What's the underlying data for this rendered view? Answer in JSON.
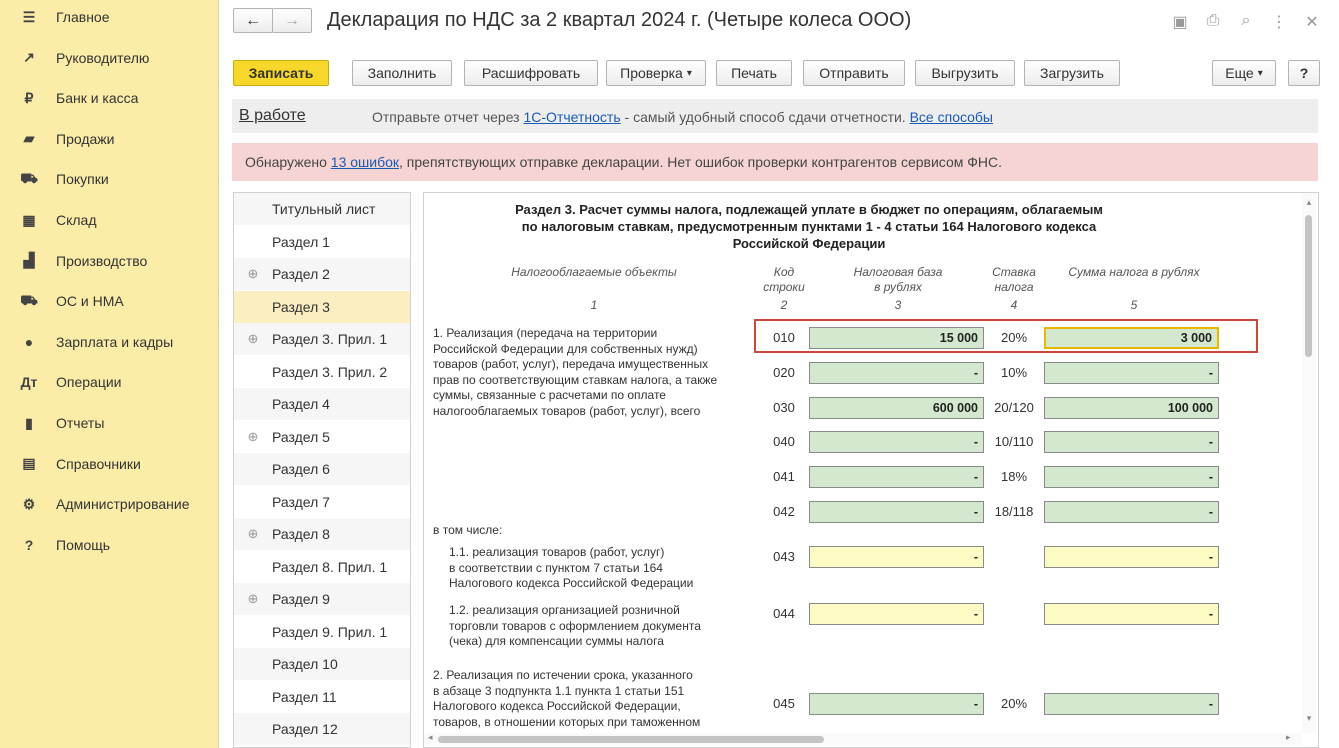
{
  "sidebar": {
    "items": [
      {
        "label": "Главное",
        "icon": "menu-icon",
        "glyph": "☰"
      },
      {
        "label": "Руководителю",
        "icon": "trend-icon",
        "glyph": "↗"
      },
      {
        "label": "Банк и касса",
        "icon": "ruble-coin-icon",
        "glyph": "₽"
      },
      {
        "label": "Продажи",
        "icon": "shopping-bag-icon",
        "glyph": "▰"
      },
      {
        "label": "Покупки",
        "icon": "cart-icon",
        "glyph": "⛟"
      },
      {
        "label": "Склад",
        "icon": "warehouse-icon",
        "glyph": "▦"
      },
      {
        "label": "Производство",
        "icon": "factory-icon",
        "glyph": "▟"
      },
      {
        "label": "ОС и НМА",
        "icon": "truck-icon",
        "glyph": "⛟"
      },
      {
        "label": "Зарплата и кадры",
        "icon": "person-icon",
        "glyph": "●"
      },
      {
        "label": "Операции",
        "icon": "dt-kt-icon",
        "glyph": "Дт"
      },
      {
        "label": "Отчеты",
        "icon": "bar-chart-icon",
        "glyph": "▮"
      },
      {
        "label": "Справочники",
        "icon": "books-icon",
        "glyph": "▤"
      },
      {
        "label": "Администрирование",
        "icon": "gear-icon",
        "glyph": "⚙"
      },
      {
        "label": "Помощь",
        "icon": "question-icon",
        "glyph": "?"
      }
    ]
  },
  "window": {
    "title": "Декларация по НДС за 2 квартал 2024 г. (Четыре колеса ООО)",
    "back_glyph": "←",
    "forward_glyph": "→",
    "icons": [
      "save-icon",
      "print-icon",
      "preview-icon",
      "more-icon",
      "close-icon"
    ],
    "icon_glyphs": [
      "▣",
      "⎙",
      "⌕",
      "⋮",
      "✕"
    ]
  },
  "toolbar": {
    "save": "Записать",
    "fill": "Заполнить",
    "decode": "Расшифровать",
    "check": "Проверка",
    "print": "Печать",
    "send": "Отправить",
    "export": "Выгрузить",
    "import": "Загрузить",
    "more": "Еще",
    "help": "?",
    "dropdown_glyph": "▾"
  },
  "status": {
    "state": "В работе",
    "text_before": "Отправьте отчет через",
    "link1": "1С-Отчетность",
    "text_middle": "- самый удобный способ сдачи отчетности.",
    "link2": "Все способы"
  },
  "alert": {
    "text_before": "Обнаружено",
    "link": "13 ошибок",
    "text_after": ", препятствующих отправке декларации. Нет ошибок проверки контрагентов сервисом ФНС.",
    "color": "#f6d4d4"
  },
  "sections": [
    {
      "label": "Титульный лист",
      "expand": false
    },
    {
      "label": "Раздел 1",
      "expand": false
    },
    {
      "label": "Раздел 2",
      "expand": true
    },
    {
      "label": "Раздел 3",
      "expand": false,
      "selected": true
    },
    {
      "label": "Раздел 3. Прил. 1",
      "expand": true
    },
    {
      "label": "Раздел 3. Прил. 2",
      "expand": false
    },
    {
      "label": "Раздел 4",
      "expand": false
    },
    {
      "label": "Раздел 5",
      "expand": true
    },
    {
      "label": "Раздел 6",
      "expand": false
    },
    {
      "label": "Раздел 7",
      "expand": false
    },
    {
      "label": "Раздел 8",
      "expand": true
    },
    {
      "label": "Раздел 8. Прил. 1",
      "expand": false
    },
    {
      "label": "Раздел 9",
      "expand": true
    },
    {
      "label": "Раздел 9. Прил. 1",
      "expand": false
    },
    {
      "label": "Раздел 10",
      "expand": false
    },
    {
      "label": "Раздел 11",
      "expand": false
    },
    {
      "label": "Раздел 12",
      "expand": false
    }
  ],
  "form": {
    "title_lines": [
      "Раздел 3. Расчет суммы налога, подлежащей уплате в бюджет по операциям, облагаемым",
      "по налоговым ставкам, предусмотренным пунктами 1 - 4 статьи 164 Налогового кодекса",
      "Российской Федерации"
    ],
    "headers": {
      "objects": "Налогооблагаемые объекты",
      "code_l1": "Код",
      "code_l2": "строки",
      "base_l1": "Налоговая база",
      "base_l2": "в рублях",
      "rate_l1": "Ставка",
      "rate_l2": "налога",
      "tax": "Сумма налога в рублях",
      "n1": "1",
      "n2": "2",
      "n3": "3",
      "n4": "4",
      "n5": "5"
    },
    "text_block1": [
      "1. Реализация (передача на территории",
      "Российской Федерации для собственных нужд)",
      "товаров (работ, услуг), передача имущественных",
      "прав по соответствующим ставкам налога, а также",
      "суммы, связанные с расчетами по оплате",
      "налогооблагаемых товаров (работ, услуг), всего"
    ],
    "including": "в том числе:",
    "text_11": [
      "1.1. реализация товаров (работ, услуг)",
      "в соответствии с пунктом 7 статьи 164",
      "Налогового кодекса Российской Федерации"
    ],
    "text_12": [
      "1.2. реализация организацией розничной",
      "торговли товаров с оформлением документа",
      "(чека) для компенсации суммы налога"
    ],
    "text_2": [
      "2. Реализация по истечении срока, указанного",
      "в абзаце 3 подпункта 1.1 пункта 1 статьи 151",
      "Налогового кодекса Российской Федерации,",
      "товаров, в отношении которых при таможенном"
    ],
    "rows": [
      {
        "code": "010",
        "base": "15 000",
        "rate": "20%",
        "tax": "3 000"
      },
      {
        "code": "020",
        "base": "-",
        "rate": "10%",
        "tax": "-"
      },
      {
        "code": "030",
        "base": "600 000",
        "rate": "20/120",
        "tax": "100 000"
      },
      {
        "code": "040",
        "base": "-",
        "rate": "10/110",
        "tax": "-"
      },
      {
        "code": "041",
        "base": "-",
        "rate": "18%",
        "tax": "-"
      },
      {
        "code": "042",
        "base": "-",
        "rate": "18/118",
        "tax": "-"
      },
      {
        "code": "043",
        "base": "-",
        "rate": "",
        "tax": "-"
      },
      {
        "code": "044",
        "base": "-",
        "rate": "",
        "tax": "-"
      },
      {
        "code": "045",
        "base": "-",
        "rate": "20%",
        "tax": "-"
      }
    ],
    "highlight_color": "#c9483c"
  },
  "scroll": {
    "up": "▴",
    "down": "▾",
    "left": "◂",
    "right": "▸"
  }
}
